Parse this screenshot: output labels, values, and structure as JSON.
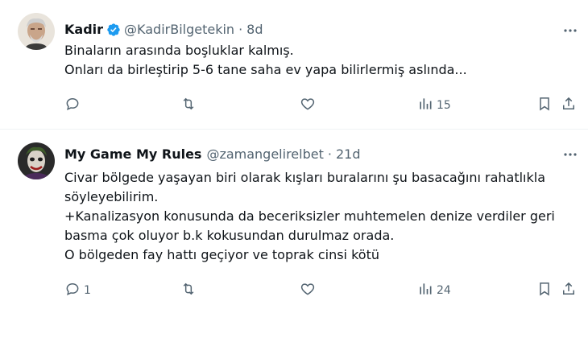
{
  "tweets": [
    {
      "name": "Kadir",
      "handle": "@KadirBilgetekin",
      "time": "8d",
      "lines": [
        "Binaların arasında boşluklar kalmış.",
        "Onları da birleştirip 5-6 tane saha ev yapa bilirlermiş aslında..."
      ],
      "actions": {
        "reply": "",
        "retweet": "",
        "like": "",
        "views": "15"
      },
      "verified": true
    },
    {
      "name": "My Game My Rules",
      "handle": "@zamangelirelbet",
      "time": "21d",
      "lines": [
        "Civar bölgede yaşayan biri olarak kışları buralarını şu basacağını rahatlıkla",
        "söyleyebilirim.",
        "+Kanalizasyon konusunda da beceriksizler muhtemelen denize verdiler geri",
        "basma çok oluyor b.k kokusundan durulmaz orada.",
        "O bölgeden fay hattı geçiyor ve toprak cinsi kötü"
      ],
      "actions": {
        "reply": "1",
        "retweet": "",
        "like": "",
        "views": "24"
      },
      "verified": false
    }
  ],
  "colors": {
    "text": "#0f1419",
    "muted": "#536471",
    "verified": "#1d9bf0",
    "divider": "#eff3f4"
  },
  "icons": [
    "avatar",
    "verified-badge-icon",
    "more-icon",
    "reply-icon",
    "retweet-icon",
    "like-icon",
    "views-icon",
    "bookmark-icon",
    "share-icon"
  ]
}
